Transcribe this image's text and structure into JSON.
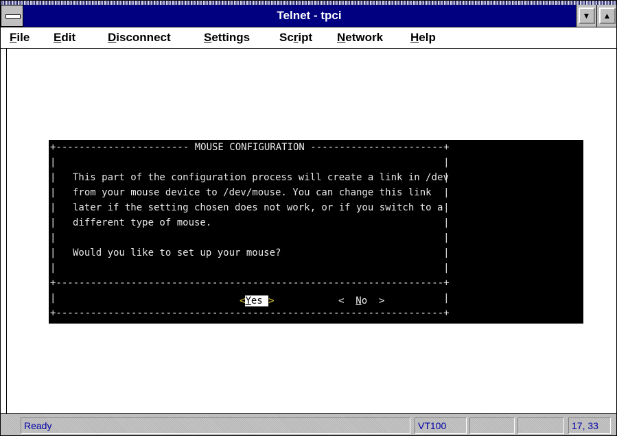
{
  "window": {
    "title": "Telnet - tpci",
    "controls": {
      "minimize_icon": "▼",
      "maximize_icon": "▲"
    }
  },
  "menu": {
    "items": [
      {
        "label": "File",
        "mnemonic": "F"
      },
      {
        "label": "Edit",
        "mnemonic": "E"
      },
      {
        "label": "Disconnect",
        "mnemonic": "D"
      },
      {
        "label": "Settings",
        "mnemonic": "S"
      },
      {
        "label": "Script",
        "mnemonic": "r"
      },
      {
        "label": "Network",
        "mnemonic": "N"
      },
      {
        "label": "Help",
        "mnemonic": "H"
      }
    ]
  },
  "dialog": {
    "title": "MOUSE CONFIGURATION",
    "body": [
      "This part of the configuration process will create a link in /dev",
      "from your mouse device to /dev/mouse. You can change this link",
      "later if the setting chosen does not work, or if you switch to a",
      "different type of mouse."
    ],
    "question": "Would you like to set up your mouse?",
    "yes_label": "Yes",
    "no_label": "No"
  },
  "status": {
    "message": "Ready",
    "terminal": "VT100",
    "cursor": "17, 33"
  },
  "colors": {
    "titlebar": "#000080",
    "terminal_bg": "#000000",
    "terminal_fg": "#e8e8e8",
    "button_bracket": "#e6d23a",
    "status_text": "#0000a8"
  }
}
